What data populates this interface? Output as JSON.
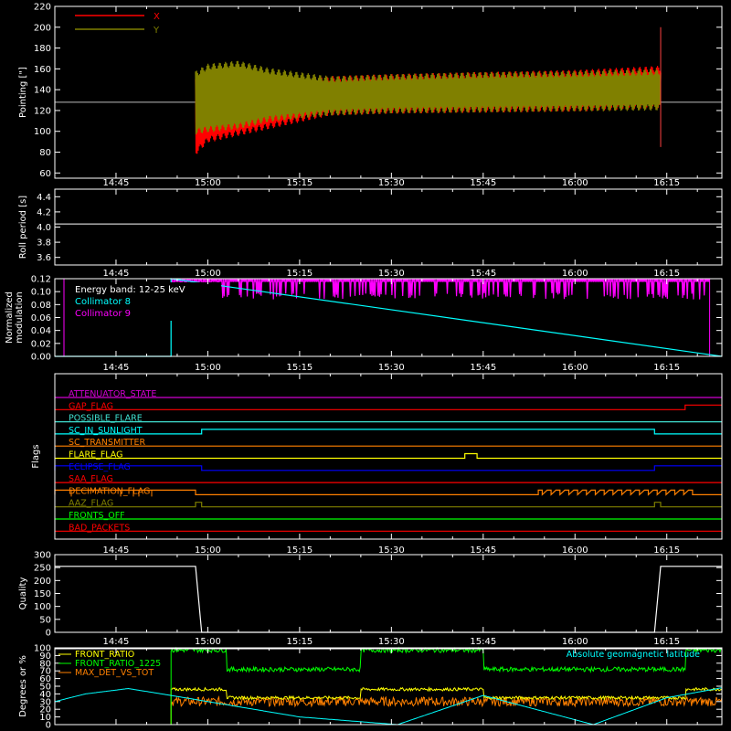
{
  "colors": {
    "background": "#000000",
    "axis": "#ffffff",
    "red": "#ff0000",
    "olive": "#808000",
    "magenta": "#ff00ff",
    "cyan": "#00ffff",
    "yellow": "#ffff00",
    "green": "#00ff00",
    "orange": "#ff8000",
    "blue": "#0000ff",
    "aquamarine": "#40e0d0",
    "purple": "#d000d0",
    "white": "#ffffff"
  },
  "time_axis": {
    "range": [
      "14:35",
      "16:24"
    ],
    "tick_labels": [
      "14:45",
      "15:00",
      "15:15",
      "15:30",
      "15:45",
      "16:00",
      "16:15"
    ],
    "tick_times": [
      "14:45",
      "15:00",
      "15:15",
      "15:30",
      "15:45",
      "16:00",
      "16:15"
    ]
  },
  "chart_data": [
    {
      "type": "line",
      "ylabel": "Pointing [\"]",
      "ylim": [
        55,
        220
      ],
      "yticks": [
        60,
        80,
        100,
        120,
        140,
        160,
        180,
        200,
        220
      ],
      "legend": {
        "placement": "top-left",
        "entries": [
          "X",
          "Y"
        ]
      },
      "baseline": 128,
      "data_start": "14:58",
      "data_end": "16:14",
      "series": [
        {
          "name": "X",
          "color": "red",
          "x": [
            "14:58",
            "15:00",
            "15:10",
            "15:20",
            "15:30",
            "15:45",
            "16:00",
            "16:14"
          ],
          "upper": [
            150,
            148,
            145,
            150,
            152,
            154,
            156,
            160
          ],
          "lower": [
            80,
            92,
            105,
            118,
            120,
            121,
            122,
            125
          ]
        },
        {
          "name": "Y",
          "color": "olive",
          "x": [
            "14:58",
            "15:00",
            "15:05",
            "15:10",
            "15:20",
            "15:30",
            "15:45",
            "16:00",
            "16:14"
          ],
          "upper": [
            155,
            162,
            165,
            158,
            150,
            152,
            154,
            155,
            157
          ],
          "lower": [
            100,
            102,
            105,
            112,
            118,
            120,
            121,
            122,
            123
          ]
        }
      ]
    },
    {
      "type": "line",
      "ylabel": "Roll period [s]",
      "ylim": [
        3.5,
        4.5
      ],
      "yticks": [
        3.6,
        3.8,
        4.0,
        4.2,
        4.4
      ],
      "series": [
        {
          "name": "",
          "color": "white",
          "x": [
            "14:35",
            "16:24"
          ],
          "values": [
            4.04,
            4.04
          ]
        }
      ]
    },
    {
      "type": "line",
      "ylabel": "Normalized modulation",
      "ylim": [
        0.0,
        0.12
      ],
      "yticks": [
        0.0,
        0.02,
        0.04,
        0.06,
        0.08,
        0.1,
        0.12
      ],
      "annotation": "Energy band: 12-25 keV",
      "legend": {
        "placement": "top-left",
        "entries": [
          "Collimator 8",
          "Collimator 9"
        ]
      },
      "series": [
        {
          "name": "Collimator 8",
          "color": "cyan",
          "x": [
            "14:35",
            "14:54",
            "14:54",
            "16:24"
          ],
          "values": [
            0.0,
            0.0,
            0.12,
            0.0
          ]
        },
        {
          "name": "Collimator 9",
          "color": "magenta",
          "x": [
            "14:54",
            "16:22"
          ],
          "upper": [
            0.12,
            0.12
          ],
          "lower": [
            0.088,
            0.088
          ]
        }
      ]
    },
    {
      "type": "line",
      "ylabel": "Flags",
      "flags": [
        {
          "name": "ATTENUATOR_STATE",
          "color": "purple",
          "high": []
        },
        {
          "name": "GAP_FLAG",
          "color": "red",
          "high": [
            [
              "16:18",
              "16:24"
            ]
          ]
        },
        {
          "name": "POSSIBLE_FLARE",
          "color": "aquamarine",
          "high": []
        },
        {
          "name": "SC_IN_SUNLIGHT",
          "color": "cyan",
          "high": [
            [
              "14:59",
              "16:13"
            ]
          ]
        },
        {
          "name": "SC_TRANSMITTER",
          "color": "orange",
          "high": []
        },
        {
          "name": "FLARE_FLAG",
          "color": "yellow",
          "high": [
            [
              "15:42",
              "15:44"
            ]
          ]
        },
        {
          "name": "ECLIPSE_FLAG",
          "color": "blue",
          "high": [
            [
              "14:35",
              "14:59"
            ],
            [
              "16:13",
              "16:24"
            ]
          ]
        },
        {
          "name": "SAA_FLAG",
          "color": "red",
          "high": []
        },
        {
          "name": "DECIMATION_FLAG",
          "color": "orange",
          "high": [
            [
              "14:35",
              "14:58"
            ],
            [
              "15:54",
              "16:20"
            ]
          ]
        },
        {
          "name": "AAZ_FLAG",
          "color": "olive",
          "high": [
            [
              "14:58",
              "14:59"
            ],
            [
              "16:13",
              "16:14"
            ]
          ]
        },
        {
          "name": "FRONTS_OFF",
          "color": "green",
          "high": []
        },
        {
          "name": "BAD_PACKETS",
          "color": "red",
          "high": []
        }
      ]
    },
    {
      "type": "line",
      "ylabel": "Quality",
      "ylim": [
        0,
        300
      ],
      "yticks": [
        0,
        50,
        100,
        150,
        200,
        250,
        300
      ],
      "series": [
        {
          "name": "",
          "color": "white",
          "x": [
            "14:35",
            "14:58",
            "14:59",
            "16:13",
            "16:14",
            "16:24"
          ],
          "values": [
            255,
            255,
            0,
            0,
            255,
            255
          ]
        }
      ]
    },
    {
      "type": "line",
      "ylabel": "Degrees or %",
      "ylim": [
        0,
        100
      ],
      "yticks": [
        0,
        10,
        20,
        30,
        40,
        50,
        60,
        70,
        80,
        90,
        100
      ],
      "legend": {
        "placement": "top-left",
        "entries": [
          "FRONT_RATIO",
          "FRONT_RATIO_1225",
          "MAX_DET_VS_TOT"
        ]
      },
      "annotation": "Absolute geomagnetic latitude",
      "series": [
        {
          "name": "FRONT_RATIO",
          "color": "white",
          "x": [
            "14:35",
            "16:24"
          ],
          "values": [
            100,
            100
          ]
        },
        {
          "name": "FRONT_RATIO_1225",
          "color": "green",
          "x": [
            "14:54",
            "15:03",
            "15:03",
            "15:25",
            "15:25",
            "15:45",
            "15:45",
            "16:18",
            "16:18"
          ],
          "values": [
            97,
            97,
            72,
            72,
            97,
            97,
            72,
            72,
            97
          ]
        },
        {
          "name": "MAX_DET_VS_TOT",
          "color": "yellow",
          "x": [
            "14:54",
            "15:03",
            "15:03",
            "15:25",
            "15:25",
            "15:45",
            "15:45",
            "16:18",
            "16:18"
          ],
          "values": [
            46,
            46,
            35,
            35,
            46,
            46,
            35,
            35,
            46
          ]
        },
        {
          "name": "",
          "color": "orange",
          "x": [
            "14:54",
            "16:24"
          ],
          "values": [
            30,
            30
          ]
        },
        {
          "name": "Absolute geomagnetic latitude",
          "color": "cyan",
          "x": [
            "14:35",
            "14:40",
            "14:47",
            "14:54",
            "15:00",
            "15:15",
            "15:31",
            "15:45",
            "16:03",
            "16:15",
            "16:24"
          ],
          "values": [
            30,
            40,
            47,
            38,
            30,
            10,
            0,
            38,
            0,
            35,
            48
          ]
        }
      ]
    }
  ]
}
